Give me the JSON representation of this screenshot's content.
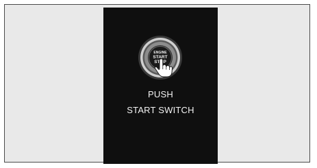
{
  "screen": {
    "button": {
      "label_lines": [
        "ENGINE",
        "START",
        "STOP"
      ],
      "icon": "power-button-icon",
      "hand_icon": "pointing-hand-icon"
    },
    "message": {
      "line1": "PUSH",
      "line2": "START SWITCH"
    }
  },
  "colors": {
    "frame_background": "#e9e9e9",
    "screen_background": "#0f0f0f",
    "ring": "#d9d9d9",
    "text": "#f2f2f2"
  }
}
